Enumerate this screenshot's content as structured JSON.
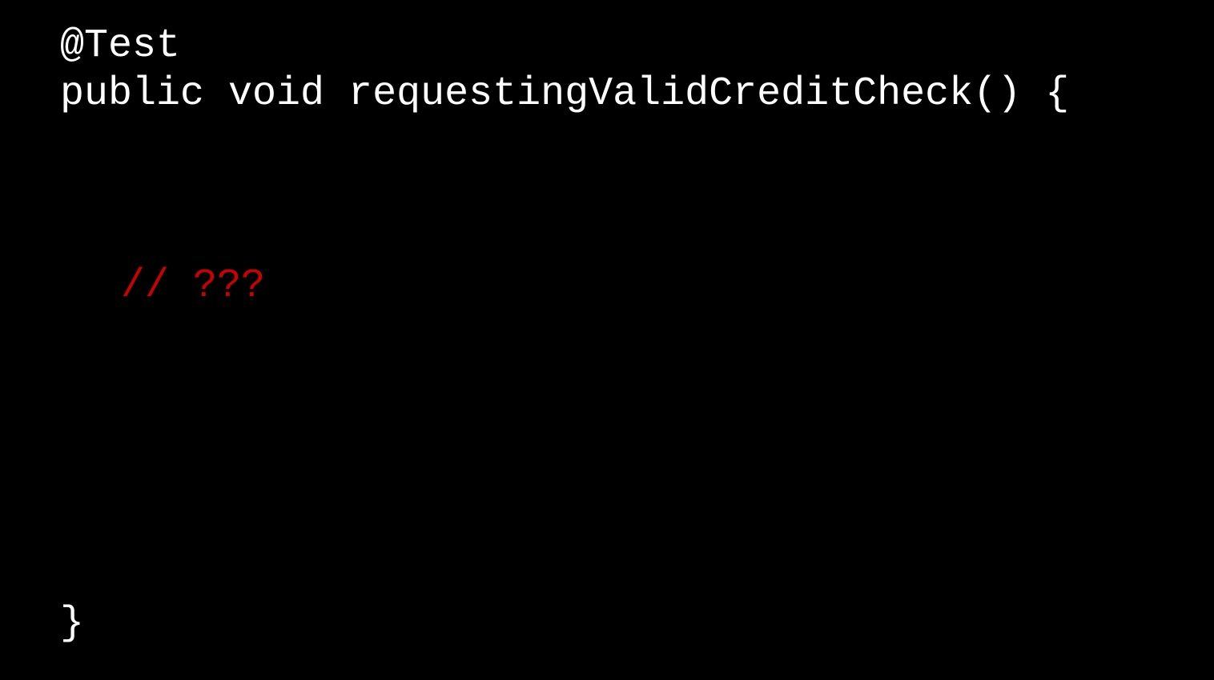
{
  "code": {
    "annotation": "@Test",
    "signature": "public void requestingValidCreditCheck() {",
    "comment": "// ???",
    "closing_brace": "}"
  },
  "colors": {
    "background": "#000000",
    "text": "#ffffff",
    "comment": "#cc0000"
  }
}
